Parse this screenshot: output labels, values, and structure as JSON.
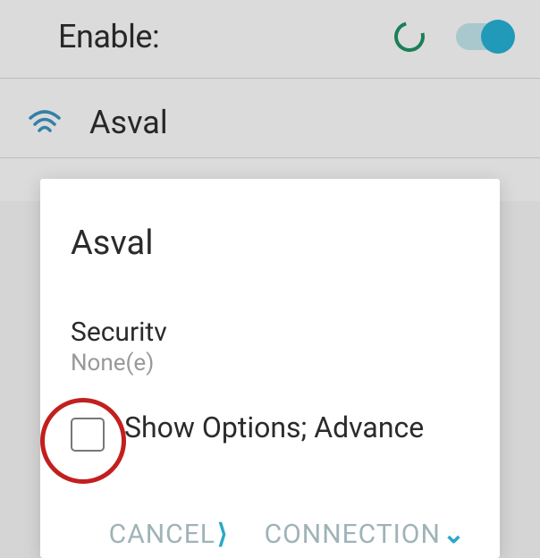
{
  "header": {
    "title": "Enable:"
  },
  "wifi": {
    "items": [
      {
        "name": "Asval"
      }
    ],
    "partial": "▯ ▢ ▢   ▢ ▢ ▮ ▮   ▢ ▢"
  },
  "dialog": {
    "title": "Asval",
    "security_label": "Securitv",
    "security_value": "None(e)",
    "advanced_label": "Show Options; Advance",
    "cancel": "CANCEL",
    "connect": "CONNECTION"
  }
}
